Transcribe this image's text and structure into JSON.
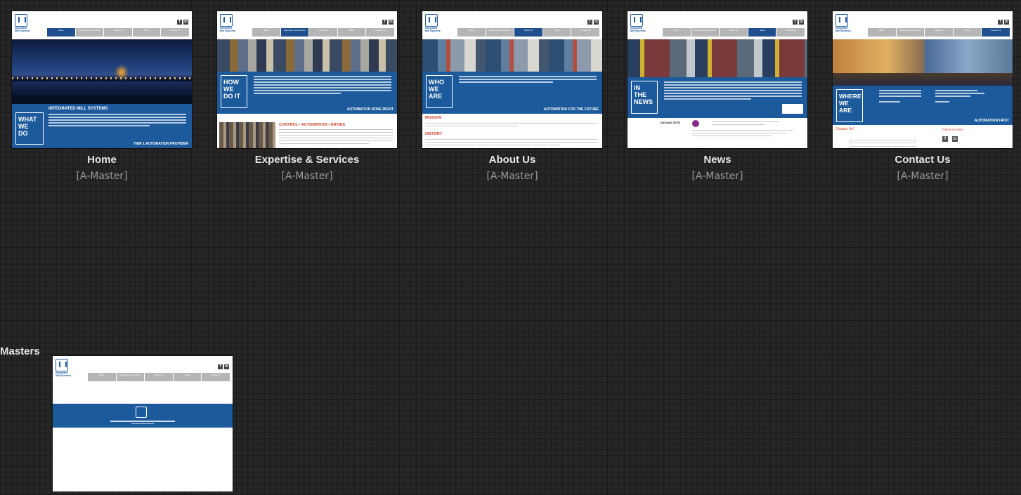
{
  "pages": [
    {
      "title": "Home",
      "master": "[A-Master]",
      "hero_text": [
        "WHAT",
        "WE",
        "DO"
      ],
      "heading": "INTEGRATED MILL SYSTEMS",
      "tagline": "TIER 1 AUTOMATION PROVIDER"
    },
    {
      "title": "Expertise & Services",
      "master": "[A-Master]",
      "hero_text": [
        "HOW",
        "WE",
        "DO IT"
      ],
      "tagline": "AUTOMATION DONE RIGHT",
      "section": "CONTROL • AUTOMATION • DRIVES"
    },
    {
      "title": "About Us",
      "master": "[A-Master]",
      "hero_text": [
        "WHO",
        "WE",
        "ARE"
      ],
      "tagline": "AUTOMATION FOR THE FUTURE",
      "sections": [
        "MISSION",
        "HISTORY"
      ]
    },
    {
      "title": "News",
      "master": "[A-Master]",
      "hero_text": [
        "IN",
        "THE",
        "NEWS"
      ],
      "date": "January 2016"
    },
    {
      "title": "Contact Us",
      "master": "[A-Master]",
      "hero_text": [
        "WHERE",
        "WE",
        "ARE"
      ],
      "tagline": "AUTOMATION FIRST",
      "contact_heading": "Contact Us!",
      "follow": "Follow us here"
    }
  ],
  "nav_items": [
    "Home",
    "Expertise and Services",
    "About Us",
    "News",
    "Contact Us"
  ],
  "logo_caption": [
    "Integrated",
    "Mill Systems"
  ],
  "social": [
    "f",
    "in"
  ],
  "masters": {
    "label": "Masters",
    "items": [
      {
        "name": "A-Master"
      }
    ]
  },
  "colors": {
    "canvas": "#262626",
    "brand_blue": "#1c5a9c",
    "nav_active": "#1f4f8c",
    "nav_inactive": "#b5b5b5",
    "accent_red": "#d6402a"
  }
}
